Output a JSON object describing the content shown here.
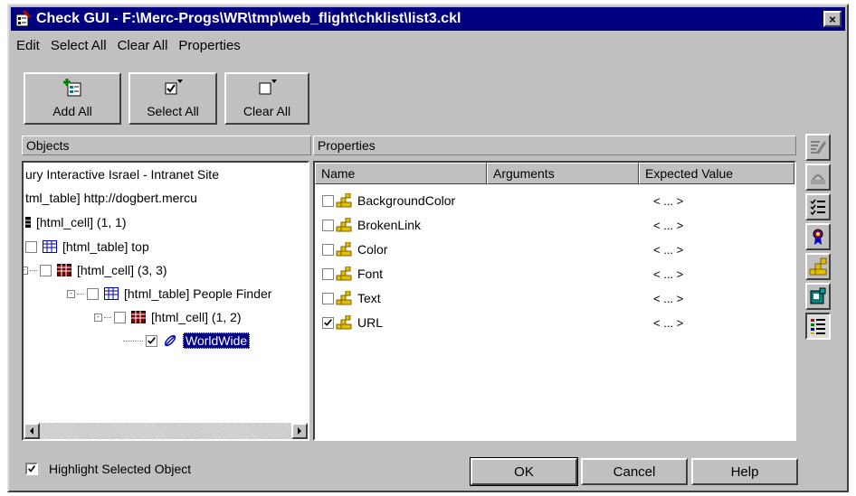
{
  "window": {
    "title": "Check GUI - F:\\Merc-Progs\\WR\\tmp\\web_flight\\chklist\\list3.ckl",
    "close_label": "×"
  },
  "menu": [
    {
      "label": "Edit"
    },
    {
      "label": "Select All"
    },
    {
      "label": "Clear All"
    },
    {
      "label": "Properties"
    }
  ],
  "toolbar": {
    "add_all": "Add All",
    "select_all": "Select All",
    "clear_all": "Clear All"
  },
  "objects": {
    "header": "Objects",
    "tree": [
      {
        "label": "ury Interactive Israel - Intranet Site"
      },
      {
        "label": "tml_table] http://dogbert.mercu"
      },
      {
        "label": "[html_cell] (1, 1)"
      },
      {
        "label": "[html_table] top"
      },
      {
        "label": "[html_cell] (3, 3)"
      },
      {
        "label": "[html_table] People Finder"
      },
      {
        "label": "[html_cell] (1, 2)"
      },
      {
        "label": "WorldWide"
      }
    ]
  },
  "properties": {
    "header": "Properties",
    "columns": [
      "Name",
      "Arguments",
      "Expected Value"
    ],
    "rows": [
      {
        "name": "BackgroundColor",
        "expected": "< ... >",
        "checked": false
      },
      {
        "name": "BrokenLink",
        "expected": "< ... >",
        "checked": false
      },
      {
        "name": "Color",
        "expected": "< ... >",
        "checked": false
      },
      {
        "name": "Font",
        "expected": "< ... >",
        "checked": false
      },
      {
        "name": "Text",
        "expected": "< ... >",
        "checked": false
      },
      {
        "name": "URL",
        "expected": "< ... >",
        "checked": true
      }
    ]
  },
  "bottom": {
    "highlight_label": "Highlight Selected Object",
    "highlight_checked": true,
    "ok": "OK",
    "cancel": "Cancel",
    "help": "Help"
  },
  "colors": {
    "titlebar": "#000080",
    "face": "#c0c0c0",
    "selection": "#000080"
  }
}
